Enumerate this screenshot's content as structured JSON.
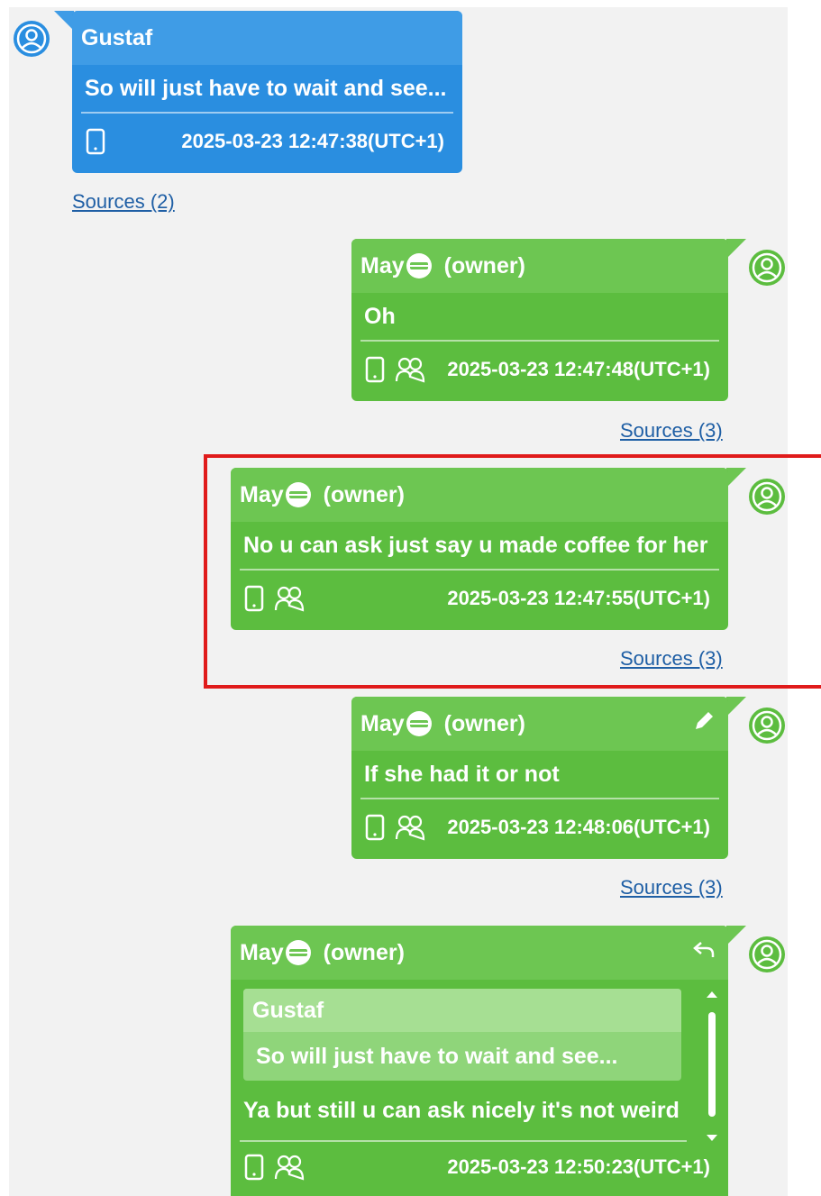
{
  "colors": {
    "incoming_bubble": "#2a8ee0",
    "outgoing_bubble": "#5cbd3f",
    "link": "#1f5fa5",
    "highlight_box": "#e01b1b"
  },
  "messages": [
    {
      "sender": "Gustaf",
      "text": "So will just have to wait and see...",
      "timestamp": "2025-03-23 12:47:38(UTC+1)",
      "sources": "Sources (2)",
      "direction": "incoming",
      "icons": [
        "phone-icon"
      ]
    },
    {
      "sender": "May",
      "role": "(owner)",
      "text": "Oh",
      "timestamp": "2025-03-23 12:47:48(UTC+1)",
      "sources": "Sources (3)",
      "direction": "outgoing",
      "icons": [
        "phone-icon",
        "group-icon"
      ]
    },
    {
      "sender": "May",
      "role": "(owner)",
      "text": "No u can ask just say u made coffee for her",
      "timestamp": "2025-03-23 12:47:55(UTC+1)",
      "sources": "Sources (3)",
      "direction": "outgoing",
      "highlighted": true,
      "icons": [
        "phone-icon",
        "group-icon"
      ]
    },
    {
      "sender": "May",
      "role": "(owner)",
      "text": "If she had it or not",
      "timestamp": "2025-03-23 12:48:06(UTC+1)",
      "sources": "Sources (3)",
      "direction": "outgoing",
      "edited": true,
      "icons": [
        "phone-icon",
        "group-icon"
      ]
    },
    {
      "sender": "May",
      "role": "(owner)",
      "quote_sender": "Gustaf",
      "quote_text": "So will just have to wait and see...",
      "text": "Ya but still u can ask nicely it's not weird",
      "timestamp": "2025-03-23 12:50:23(UTC+1)",
      "direction": "outgoing",
      "reply": true,
      "icons": [
        "phone-icon",
        "group-icon"
      ]
    }
  ]
}
